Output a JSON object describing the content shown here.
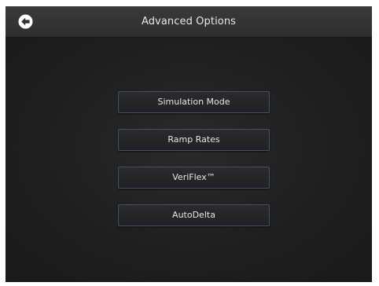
{
  "header": {
    "title": "Advanced Options",
    "back_icon": "arrow-left-circle-icon"
  },
  "options": [
    {
      "label": "Simulation Mode"
    },
    {
      "label": "Ramp Rates"
    },
    {
      "label": "VeriFlex™"
    },
    {
      "label": "AutoDelta"
    }
  ],
  "colors": {
    "background": "#1d1d1d",
    "header": "#333333",
    "button_border": "#3b5568",
    "text": "#e6e6e6"
  }
}
